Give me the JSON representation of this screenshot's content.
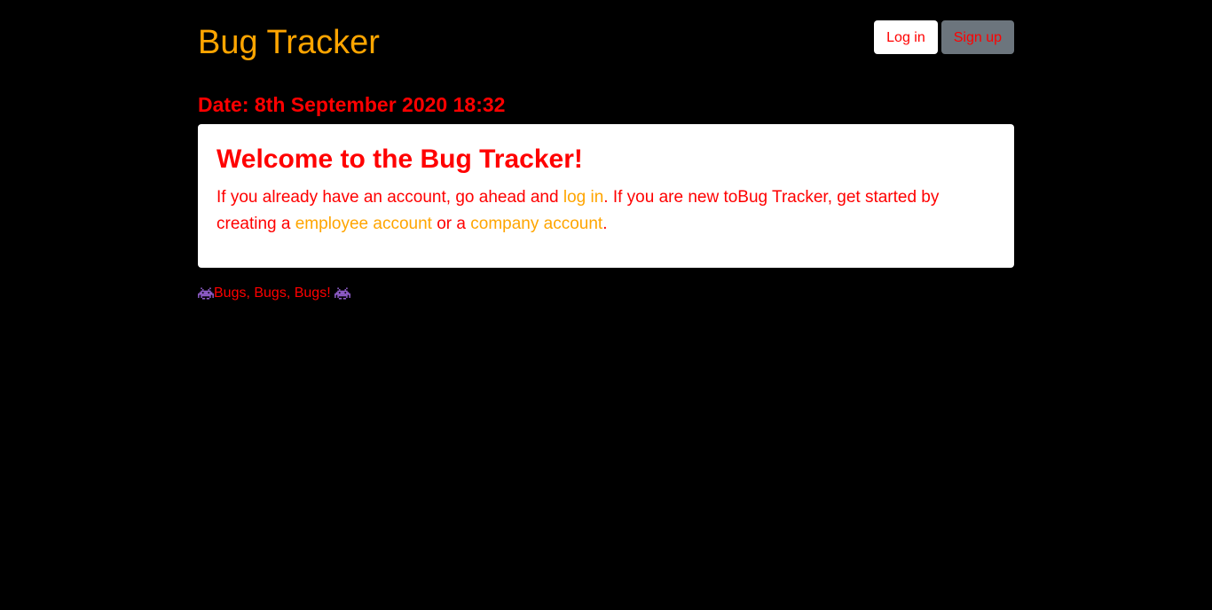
{
  "header": {
    "brand": "Bug Tracker",
    "login_label": "Log in",
    "signup_label": "Sign up"
  },
  "date_line": "Date: 8th September 2020 18:32",
  "welcome": {
    "title": "Welcome to the Bug Tracker!",
    "text_1": "If you already have an account, go ahead and ",
    "link_login": "log in",
    "text_2": ". If you are new toBug Tracker, get started by creating a ",
    "link_employee": "employee account",
    "text_3": " or a ",
    "link_company": "company account",
    "text_4": "."
  },
  "footer": {
    "text": "Bugs, Bugs, Bugs! ",
    "icon": "alien-monster-icon"
  },
  "colors": {
    "background": "#000000",
    "brand": "#ffa500",
    "text": "#ff0000",
    "link": "#ffa500",
    "card": "#ffffff",
    "signup_button": "#6c757d"
  }
}
